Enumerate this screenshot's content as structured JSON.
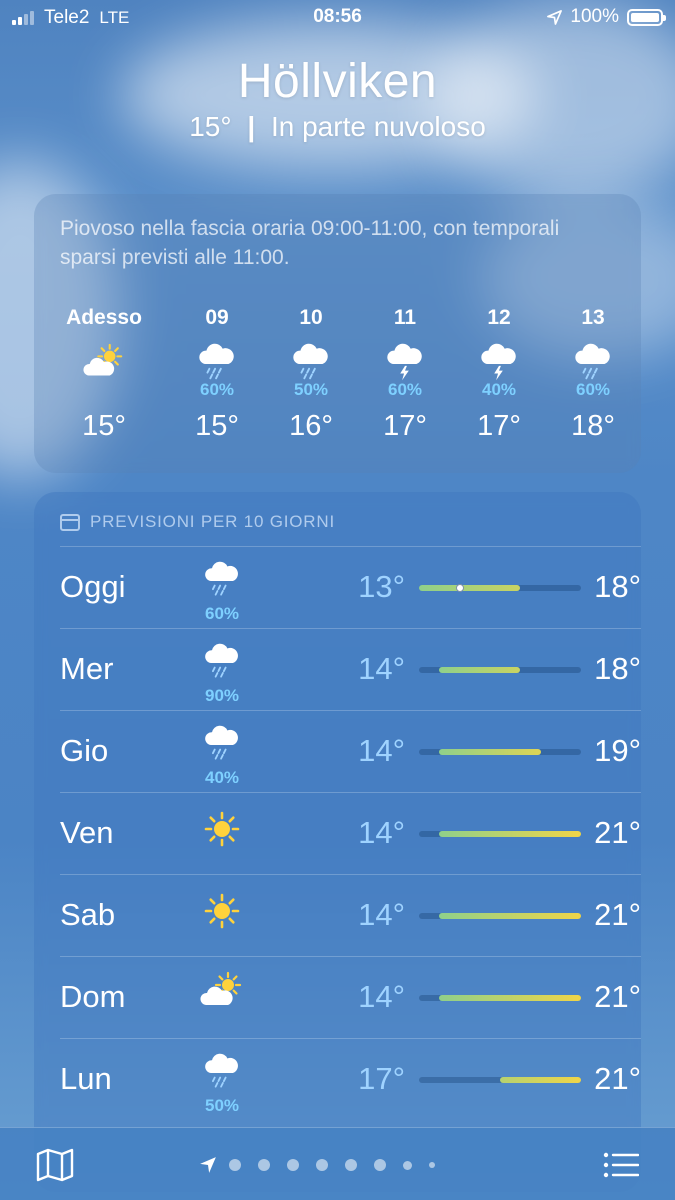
{
  "status": {
    "carrier": "Tele2",
    "network": "LTE",
    "time": "08:56",
    "battery": "100%"
  },
  "header": {
    "city": "Höllviken",
    "current_temp": "15°",
    "separator": "|",
    "condition": "In parte nuvoloso"
  },
  "hourly": {
    "summary": "Piovoso nella fascia oraria 09:00-11:00, con temporali sparsi previsti alle 11:00.",
    "hours": [
      {
        "label": "Adesso",
        "icon": "partly-cloudy-sun-icon",
        "precip": "",
        "temp": "15°"
      },
      {
        "label": "09",
        "icon": "cloud-rain-icon",
        "precip": "60%",
        "temp": "15°"
      },
      {
        "label": "10",
        "icon": "cloud-rain-icon",
        "precip": "50%",
        "temp": "16°"
      },
      {
        "label": "11",
        "icon": "cloud-thunder-icon",
        "precip": "60%",
        "temp": "17°"
      },
      {
        "label": "12",
        "icon": "cloud-thunder-icon",
        "precip": "40%",
        "temp": "17°"
      },
      {
        "label": "13",
        "icon": "cloud-rain-icon",
        "precip": "60%",
        "temp": "18°"
      }
    ]
  },
  "daily": {
    "heading": "PREVISIONI PER 10 GIORNI",
    "range_min": 13,
    "range_max": 21,
    "days": [
      {
        "day": "Oggi",
        "icon": "cloud-rain-icon",
        "precip": "60%",
        "low": "13°",
        "high": "18°",
        "low_val": 13,
        "high_val": 18,
        "current_val": 15
      },
      {
        "day": "Mer",
        "icon": "cloud-rain-icon",
        "precip": "90%",
        "low": "14°",
        "high": "18°",
        "low_val": 14,
        "high_val": 18
      },
      {
        "day": "Gio",
        "icon": "cloud-rain-icon",
        "precip": "40%",
        "low": "14°",
        "high": "19°",
        "low_val": 14,
        "high_val": 19
      },
      {
        "day": "Ven",
        "icon": "sun-icon",
        "precip": "",
        "low": "14°",
        "high": "21°",
        "low_val": 14,
        "high_val": 21
      },
      {
        "day": "Sab",
        "icon": "sun-icon",
        "precip": "",
        "low": "14°",
        "high": "21°",
        "low_val": 14,
        "high_val": 21
      },
      {
        "day": "Dom",
        "icon": "partly-cloudy-sun-icon",
        "precip": "",
        "low": "14°",
        "high": "21°",
        "low_val": 14,
        "high_val": 21
      },
      {
        "day": "Lun",
        "icon": "cloud-rain-icon",
        "precip": "50%",
        "low": "17°",
        "high": "21°",
        "low_val": 17,
        "high_val": 21
      }
    ]
  },
  "colors": {
    "precip": "#7ed0ff",
    "bar_cool": "#8fd08a",
    "bar_warm": "#f0d548",
    "sun": "#ffd23c"
  },
  "tabbar": {
    "page_count": 9,
    "current_page": 0
  }
}
